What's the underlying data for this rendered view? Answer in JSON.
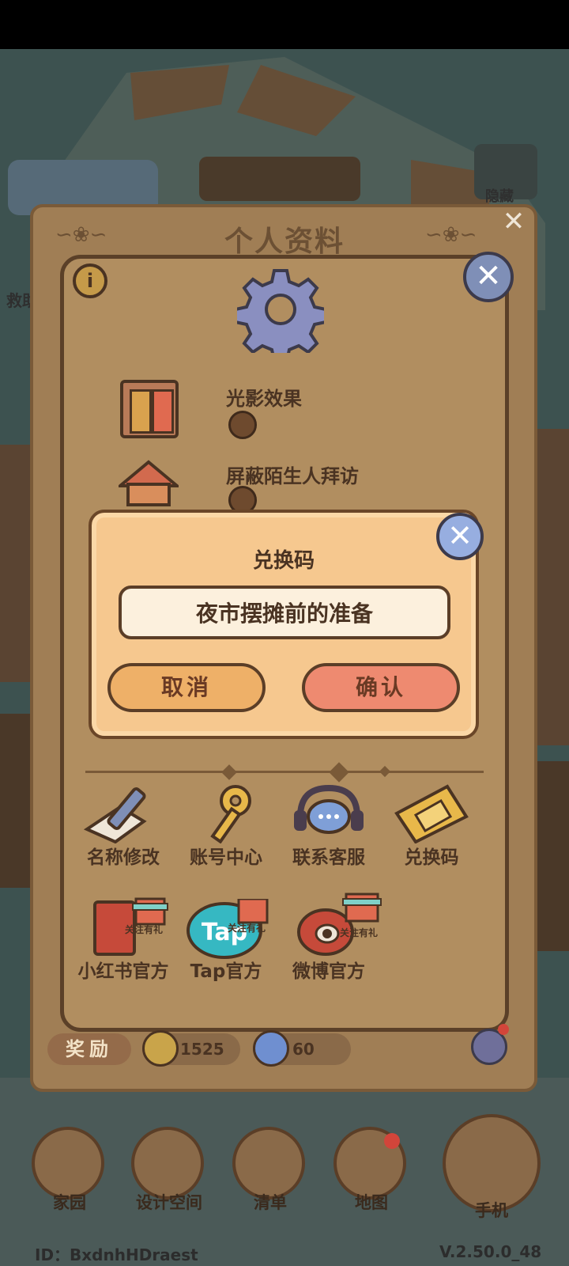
{
  "profile_panel": {
    "title": "个人资料",
    "settings": [
      {
        "label": "光影效果",
        "icon": "window-icon"
      },
      {
        "label": "屏蔽陌生人拜访",
        "icon": "house-icon"
      }
    ],
    "shortcuts_row1": [
      {
        "label": "名称修改",
        "icon": "pencil-icon"
      },
      {
        "label": "账号中心",
        "icon": "key-icon"
      },
      {
        "label": "联系客服",
        "icon": "headset-icon"
      },
      {
        "label": "兑换码",
        "icon": "ticket-icon"
      }
    ],
    "shortcuts_row2": [
      {
        "label": "小红书官方",
        "icon": "book-icon",
        "badge": "关注有礼"
      },
      {
        "label": "Tap官方",
        "icon": "tap-logo-icon",
        "badge": "关注有礼"
      },
      {
        "label": "微博官方",
        "icon": "weibo-icon",
        "badge": "关注有礼"
      }
    ],
    "rewards": {
      "label": "奖励",
      "coins": "1525",
      "gems": "60"
    }
  },
  "redeem_modal": {
    "title": "兑换码",
    "input_value": "夜市摆摊前的准备",
    "cancel_label": "取消",
    "confirm_label": "确认"
  },
  "hud": {
    "left_label_partial": "救助",
    "hide_label": "隐藏"
  },
  "bottom_nav": [
    {
      "label": "家园",
      "icon": "home-icon"
    },
    {
      "label": "设计空间",
      "icon": "design-icon"
    },
    {
      "label": "清单",
      "icon": "list-icon"
    },
    {
      "label": "地图",
      "icon": "map-pin-icon"
    },
    {
      "label": "手机",
      "icon": "phone-icon"
    }
  ],
  "footer": {
    "player_id": "ID：BxdnhHDraest",
    "version": "V.2.50.0_48"
  },
  "colors": {
    "panel": "#b18e60",
    "modal": "#f6c88f",
    "cancel": "#eeb068",
    "confirm": "#ee8a70",
    "close": "#7f8fb7"
  }
}
